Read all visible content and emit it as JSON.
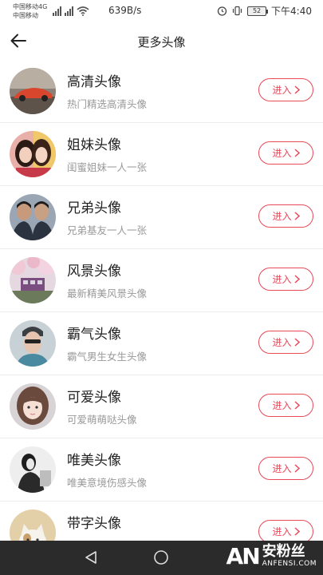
{
  "status_bar": {
    "carrier1": "中国移动4G",
    "carrier2": "中国移动",
    "network": "4G",
    "speed": "639B/s",
    "battery": "52",
    "time": "下午4:40"
  },
  "header": {
    "title": "更多头像",
    "back_icon": "arrow-left-icon"
  },
  "accent_color": "#e84a5a",
  "items": [
    {
      "title": "高清头像",
      "desc": "热门精选高清头像",
      "button": "进入",
      "avatar": "sports-car-avatar"
    },
    {
      "title": "姐妹头像",
      "desc": "闺蜜姐妹一人一张",
      "button": "进入",
      "avatar": "sisters-avatar"
    },
    {
      "title": "兄弟头像",
      "desc": "兄弟基友一人一张",
      "button": "进入",
      "avatar": "brothers-avatar"
    },
    {
      "title": "风景头像",
      "desc": "最新精美风景头像",
      "button": "进入",
      "avatar": "scenery-avatar"
    },
    {
      "title": "霸气头像",
      "desc": "霸气男生女生头像",
      "button": "进入",
      "avatar": "domineering-avatar"
    },
    {
      "title": "可爱头像",
      "desc": "可爱萌萌哒头像",
      "button": "进入",
      "avatar": "cute-avatar"
    },
    {
      "title": "唯美头像",
      "desc": "唯美意境伤感头像",
      "button": "进入",
      "avatar": "aesthetic-avatar"
    },
    {
      "title": "带字头像",
      "desc": "",
      "button": "进入",
      "avatar": "cat-with-text-avatar"
    }
  ],
  "watermark": {
    "logo": "AN",
    "cn": "安粉丝",
    "en": "ANFENSI.COM"
  }
}
